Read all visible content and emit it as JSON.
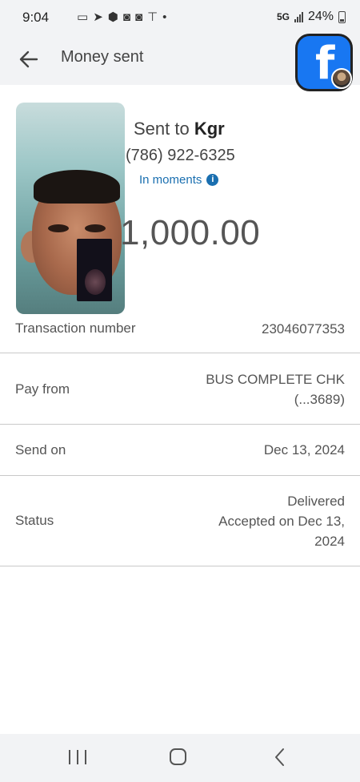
{
  "status_bar": {
    "time": "9:04",
    "network": "5G",
    "battery": "24%",
    "notification_icons": [
      "video-icon",
      "send-icon",
      "app-icon",
      "app-icon",
      "app-icon",
      "app-icon",
      "dot"
    ]
  },
  "header": {
    "title": "Money sent"
  },
  "summary": {
    "sent_to_prefix": "Sent to",
    "recipient": "Kgr",
    "phone": "(786) 922-6325",
    "timing": "In moments",
    "amount": "1,000.00"
  },
  "details": {
    "transaction_label": "Transaction number",
    "transaction_value": "23046077353",
    "pay_from_label": "Pay from",
    "pay_from_line1": "BUS COMPLETE CHK",
    "pay_from_line2": "(...3689)",
    "send_on_label": "Send on",
    "send_on_value": "Dec 13, 2024",
    "status_label": "Status",
    "status_line1": "Delivered",
    "status_line2": "Accepted on Dec 13,",
    "status_line3": "2024"
  },
  "colors": {
    "link": "#1a6fb0",
    "facebook": "#1877f2",
    "chrome_bg": "#f2f3f5"
  }
}
